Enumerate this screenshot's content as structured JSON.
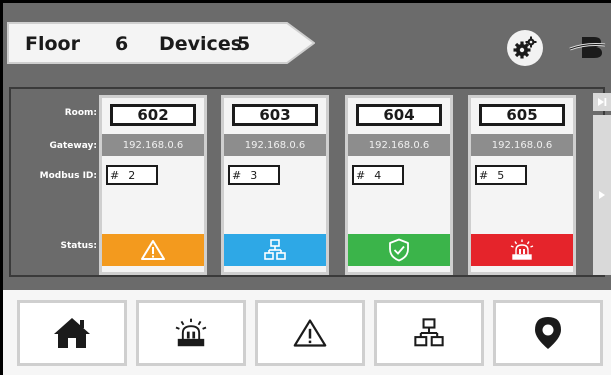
{
  "header": {
    "floor_label": "Floor",
    "floor_value": "6",
    "devices_label": "Devices",
    "devices_value": "5"
  },
  "row_labels": {
    "room": "Room:",
    "gateway": "Gateway:",
    "modbus": "Modbus ID:",
    "status": "Status:"
  },
  "devices": [
    {
      "room": "602",
      "gateway": "192.168.0.6",
      "modbus_prefix": "#",
      "modbus_id": "2",
      "status": "warning",
      "status_color": "#f39a1e"
    },
    {
      "room": "603",
      "gateway": "192.168.0.6",
      "modbus_prefix": "#",
      "modbus_id": "3",
      "status": "network",
      "status_color": "#2ea8e6"
    },
    {
      "room": "604",
      "gateway": "192.168.0.6",
      "modbus_prefix": "#",
      "modbus_id": "4",
      "status": "ok",
      "status_color": "#3bb44a"
    },
    {
      "room": "605",
      "gateway": "192.168.0.6",
      "modbus_prefix": "#",
      "modbus_id": "5",
      "status": "alarm",
      "status_color": "#e5242b"
    }
  ],
  "nav": [
    "home-icon",
    "alarm-light-icon",
    "warning-icon",
    "network-icon",
    "location-pin-icon"
  ],
  "colors": {
    "background": "#6b6b6b",
    "header_bg": "#f4f4f4",
    "gateway_bar": "#8d8d8d"
  }
}
